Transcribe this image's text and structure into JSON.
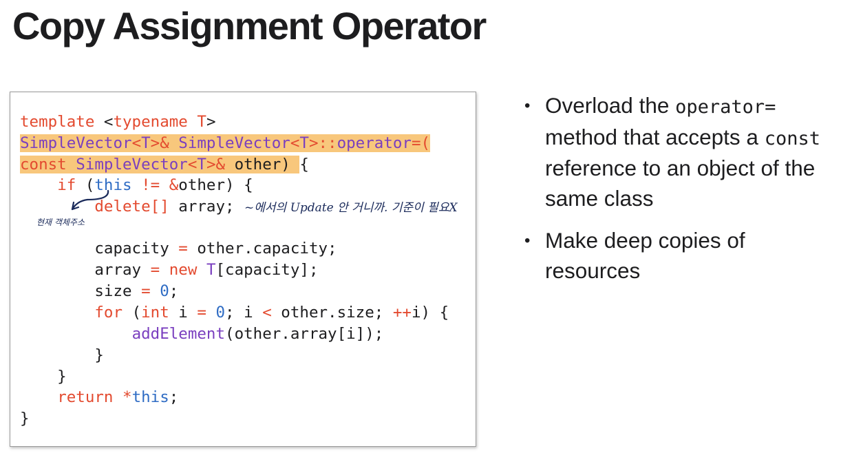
{
  "slide": {
    "title": "Copy Assignment Operator"
  },
  "code": {
    "l1": {
      "a": "template ",
      "b": "<",
      "c": "typename ",
      "d": "T",
      "e": ">"
    },
    "l2": {
      "a": "SimpleVector",
      "b": "<",
      "c": "T",
      "d": ">& ",
      "e": "SimpleVector",
      "f": "<",
      "g": "T",
      "h": ">::",
      "i": "operator",
      "j": "=("
    },
    "l3": {
      "a": "const ",
      "b": "SimpleVector",
      "c": "<",
      "d": "T",
      "e": ">& ",
      "f": "other) ",
      "g": "{"
    },
    "l4": {
      "a": "    ",
      "b": "if",
      "c": " (",
      "d": "this",
      "e": " ",
      "f": "!=",
      "g": " ",
      "h": "&",
      "i": "other) {"
    },
    "l5": {
      "a": "        ",
      "b": "delete[]",
      "c": " array;"
    },
    "l6": {
      "a": "        ",
      "b": "capacity",
      "c": " ",
      "d": "=",
      "e": " other.capacity;"
    },
    "l7": {
      "a": "        array ",
      "b": "=",
      "c": " ",
      "d": "new",
      "e": " ",
      "f": "T",
      "g": "[capacity];"
    },
    "l8": {
      "a": "        size ",
      "b": "=",
      "c": " ",
      "d": "0",
      "e": ";"
    },
    "l9": {
      "a": "        ",
      "b": "for",
      "c": " (",
      "d": "int",
      "e": " i ",
      "f": "=",
      "g": " ",
      "h": "0",
      "i": "; i ",
      "j": "<",
      "k": " other.size; ",
      "l": "++",
      "m": "i) {"
    },
    "l10": {
      "a": "            ",
      "b": "addElement",
      "c": "(other.array[i]);"
    },
    "l11": {
      "a": "        }"
    },
    "l12": {
      "a": "    }"
    },
    "l13": {
      "a": "    ",
      "b": "return",
      "c": " ",
      "d": "*",
      "e": "this",
      "f": ";"
    },
    "l14": {
      "a": "}"
    }
  },
  "annotations": {
    "note_right": "~에서의 Update 안 거니까. 기준이 필요X",
    "note_left": "현재 객체주소"
  },
  "bullets": [
    {
      "pre": "Overload the ",
      "code": "operator=",
      "post": " method that accepts a ",
      "code2": "const",
      "post2": " reference to an object of the same class"
    },
    {
      "pre": "Make deep copies of resources"
    }
  ],
  "colors": {
    "highlight": "#f8c77c",
    "keyword": "#e34a2f",
    "type": "#7a3fbf",
    "builtin": "#2f6cc4",
    "ink": "#1a2a5a"
  }
}
